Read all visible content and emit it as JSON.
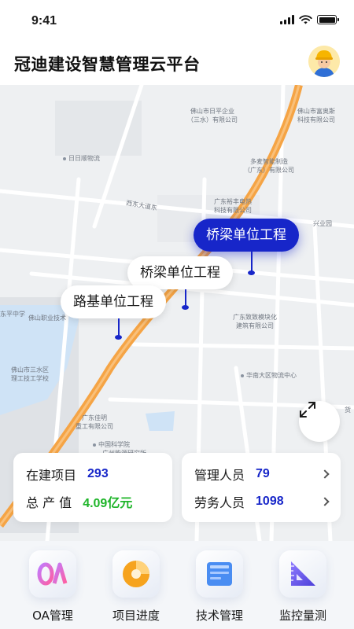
{
  "status_bar": {
    "time": "9:41"
  },
  "header": {
    "title": "冠迪建设智慧管理云平台",
    "avatar_icon": "worker-avatar-icon"
  },
  "map": {
    "labels": {
      "foshan_riping": "佛山市日平企业\n（三水）有限公司",
      "foshan_fuao": "佛山市富奥斯\n科技有限公司",
      "rishun": "日日顺物流",
      "duomai": "多麦智能制造\n（广东）有限公司",
      "xidong_road": "西东大道东",
      "guangdong_yufeng": "广东裕丰电热\n科技有限公司",
      "xingyeyuan": "兴业园",
      "foshan_vocational": "佛山职业技术",
      "ping_middle": "东平中学",
      "guangdong_zhizhi": "广东致致模块化\n建筑有限公司",
      "huanan_logistics": "华南大区物流中心",
      "foshan_sanshui": "佛山市三水区\n理工技工学校",
      "guangdong_jiaming": "广东佳明\n重工有限公司",
      "cas": "中国科学院",
      "guangzhou_energy": "广州能源研究所",
      "huo": "货"
    },
    "markers": [
      {
        "label": "桥梁单位工程",
        "style": "active"
      },
      {
        "label": "桥梁单位工程",
        "style": "normal"
      },
      {
        "label": "路基单位工程",
        "style": "normal"
      }
    ],
    "expand_icon": "fullscreen-icon"
  },
  "stats": {
    "projects_label": "在建项目",
    "projects_value": "293",
    "output_label": "总 产 值",
    "output_value": "4.09亿元",
    "managers_label": "管理人员",
    "managers_value": "79",
    "workers_label": "劳务人员",
    "workers_value": "1098"
  },
  "colors": {
    "accent": "#1726c9",
    "green": "#1fb52a",
    "road": "#f5a445"
  },
  "nav": [
    {
      "label": "OA管理",
      "icon": "oa-icon"
    },
    {
      "label": "项目进度",
      "icon": "pie-chart-icon"
    },
    {
      "label": "技术管理",
      "icon": "document-icon"
    },
    {
      "label": "监控量测",
      "icon": "ruler-triangle-icon"
    }
  ]
}
